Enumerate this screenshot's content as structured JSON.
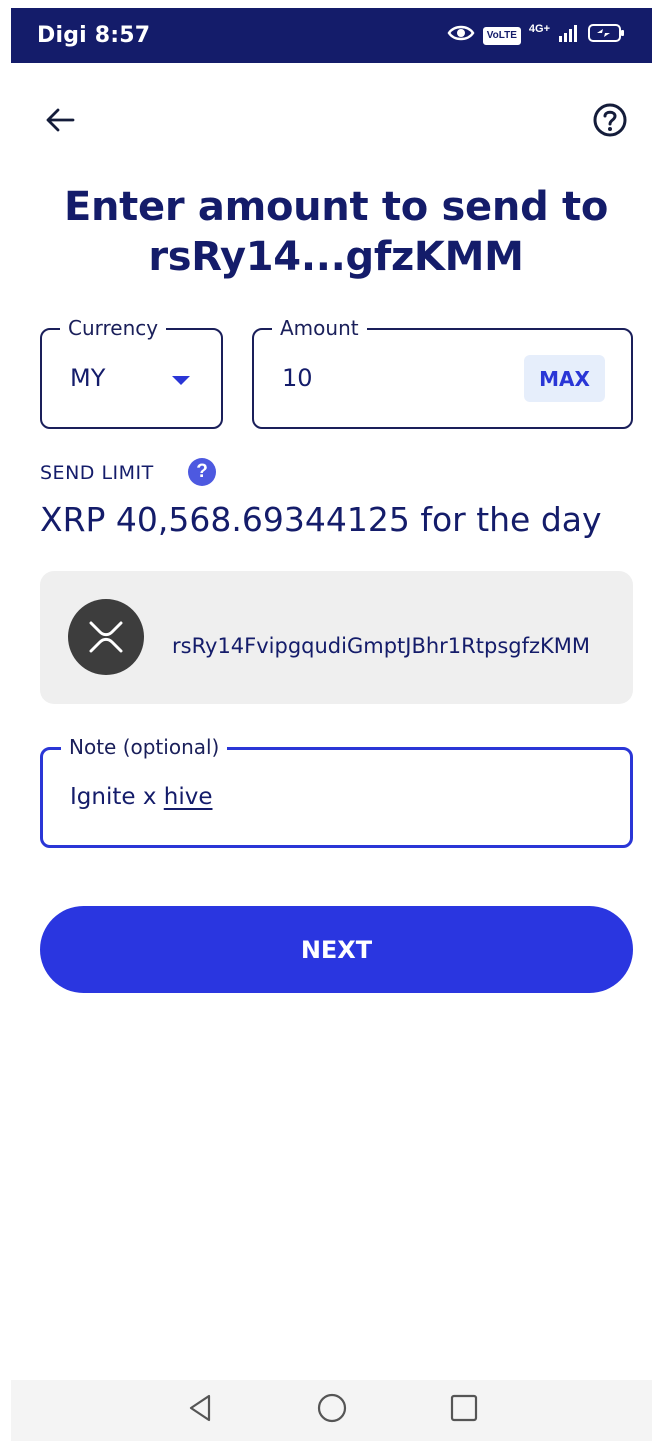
{
  "status_bar": {
    "carrier_time": "Digi 8:57",
    "volte": "VoLTE",
    "network": "4G+"
  },
  "header": {
    "title": "Enter amount to send to rsRy14...gfzKMM"
  },
  "currency_field": {
    "label": "Currency",
    "value": "MY"
  },
  "amount_field": {
    "label": "Amount",
    "value": "10",
    "max_label": "MAX"
  },
  "send_limit": {
    "label": "SEND LIMIT",
    "help_glyph": "?",
    "value": "XRP 40,568.69344125 for the day"
  },
  "recipient": {
    "address": "rsRy14FvipgqudiGmptJBhr1RtpsgfzKMM",
    "icon": "xrp-icon"
  },
  "note_field": {
    "label": "Note (optional)",
    "value_plain": "Ignite x ",
    "value_underlined": "hive"
  },
  "next_button": {
    "label": "NEXT"
  },
  "colors": {
    "primary": "#2a36e0",
    "dark_navy": "#141c6a",
    "card_bg": "#efefef",
    "max_bg": "#e6eefb"
  }
}
